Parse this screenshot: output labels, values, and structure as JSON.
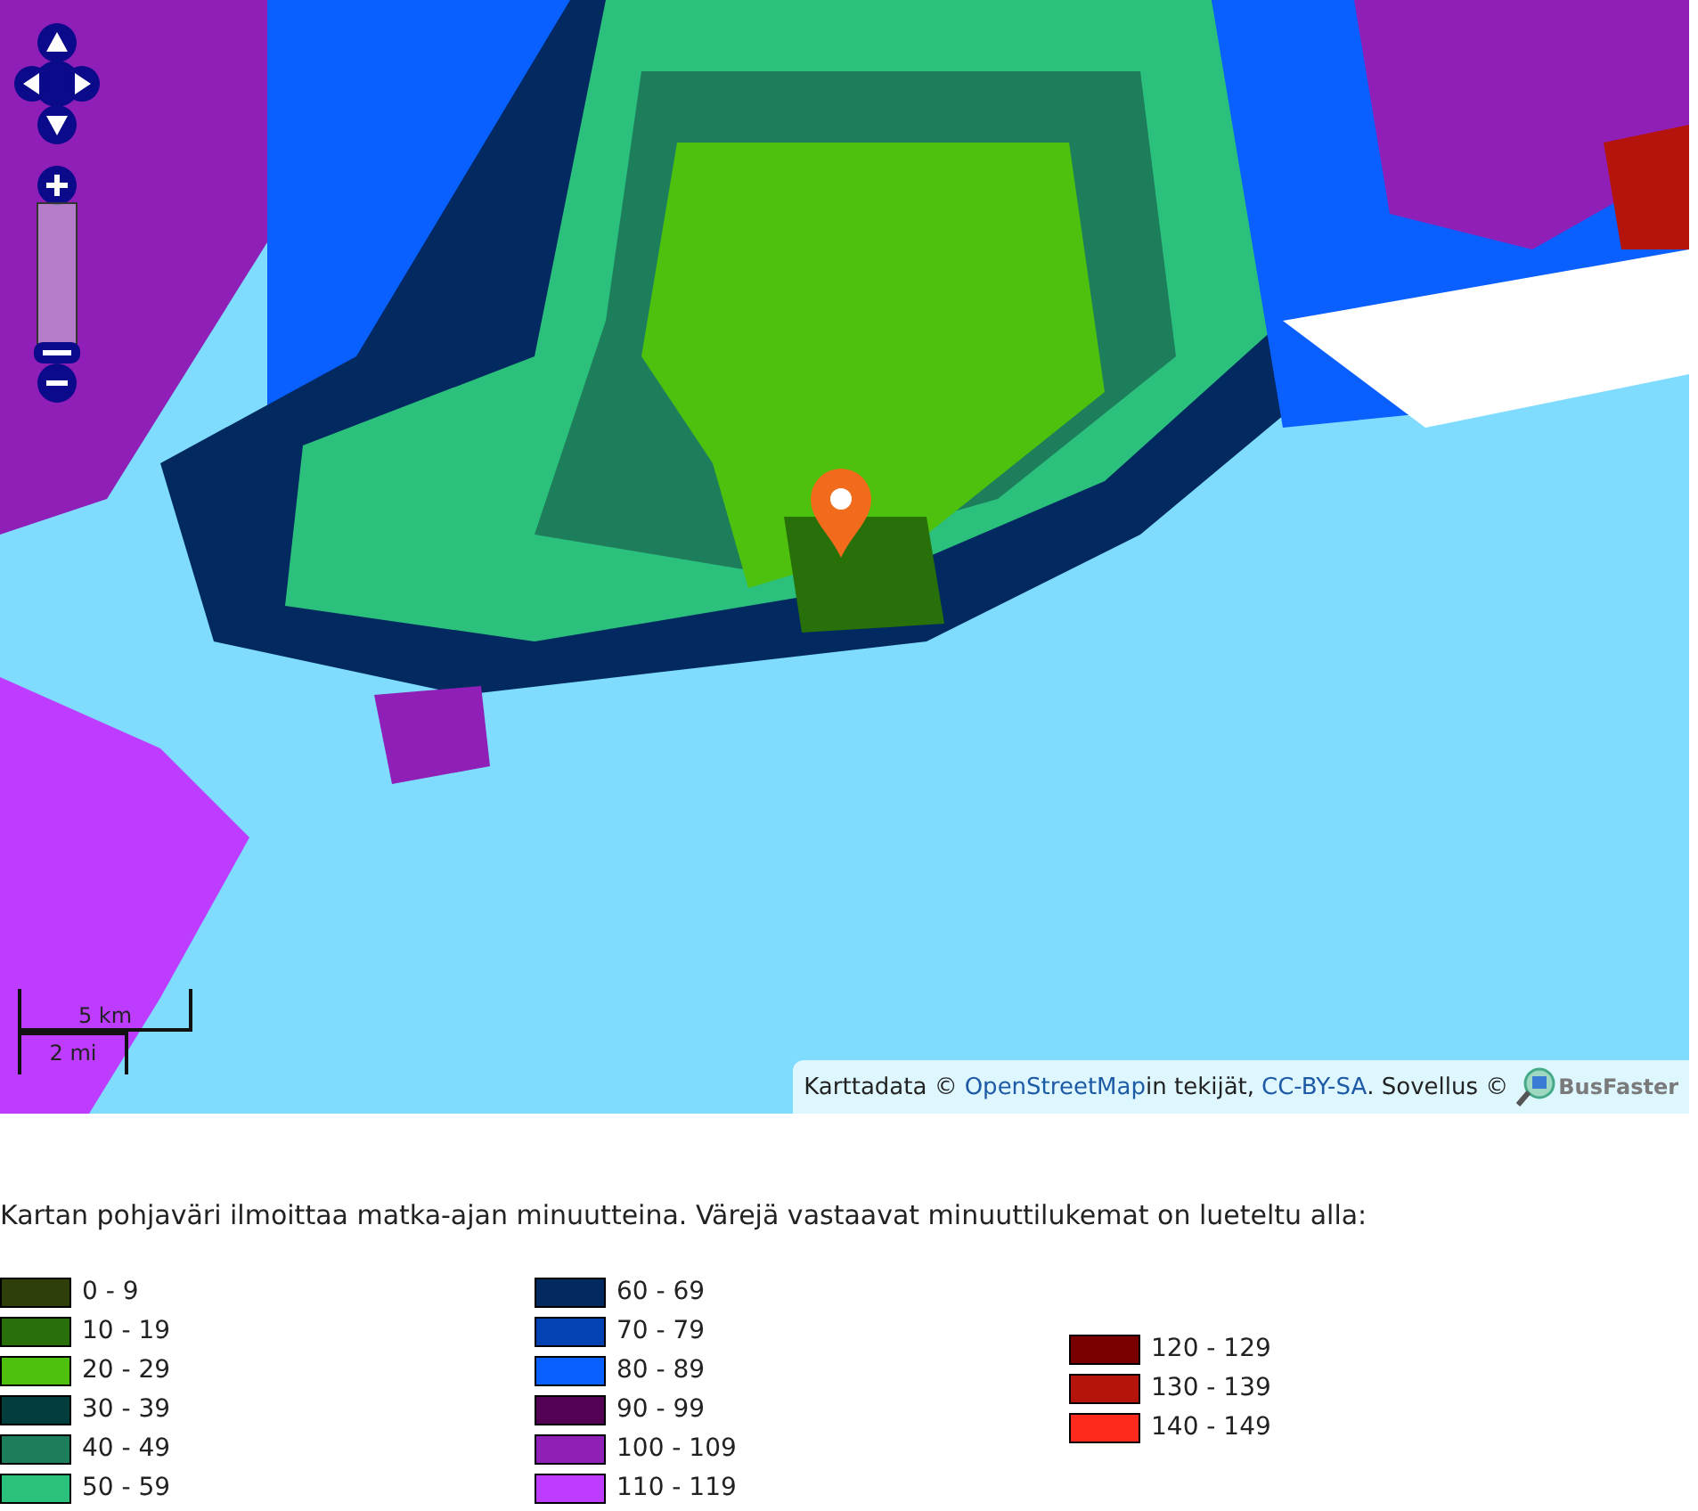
{
  "map": {
    "scale_bar": {
      "metric": "5 km",
      "imperial": "2 mi"
    },
    "attribution": {
      "prefix": "Karttadata ©",
      "link1": "OpenStreetMap",
      "middle": "in tekijät,",
      "link2": "CC-BY-SA",
      "suffix": ". Sovellus ©",
      "logo": "BusFaster"
    }
  },
  "description": "Kartan pohjaväri ilmoittaa matka-ajan minuutteina. Värejä vastaavat minuuttilukemat on lueteltu alla:",
  "legend": [
    {
      "items": [
        {
          "label": "0 - 9",
          "color": "#2f3f0a"
        },
        {
          "label": "10 - 19",
          "color": "#27700a"
        },
        {
          "label": "20 - 29",
          "color": "#4ec10e"
        },
        {
          "label": "30 - 39",
          "color": "#033d3d"
        },
        {
          "label": "40 - 49",
          "color": "#1d7e5c"
        },
        {
          "label": "50 - 59",
          "color": "#2bc07c"
        }
      ]
    },
    {
      "items": [
        {
          "label": "60 - 69",
          "color": "#022a60"
        },
        {
          "label": "70 - 79",
          "color": "#0442b4"
        },
        {
          "label": "80 - 89",
          "color": "#0a5fff"
        },
        {
          "label": "90 - 99",
          "color": "#540055"
        },
        {
          "label": "100 - 109",
          "color": "#8f1fb6"
        },
        {
          "label": "110 - 119",
          "color": "#bd3cff"
        }
      ]
    },
    {
      "items": [
        {
          "label": "120 - 129",
          "color": "#780000"
        },
        {
          "label": "130 - 139",
          "color": "#b5140d"
        },
        {
          "label": "140 - 149",
          "color": "#ff2a1e"
        }
      ]
    }
  ]
}
